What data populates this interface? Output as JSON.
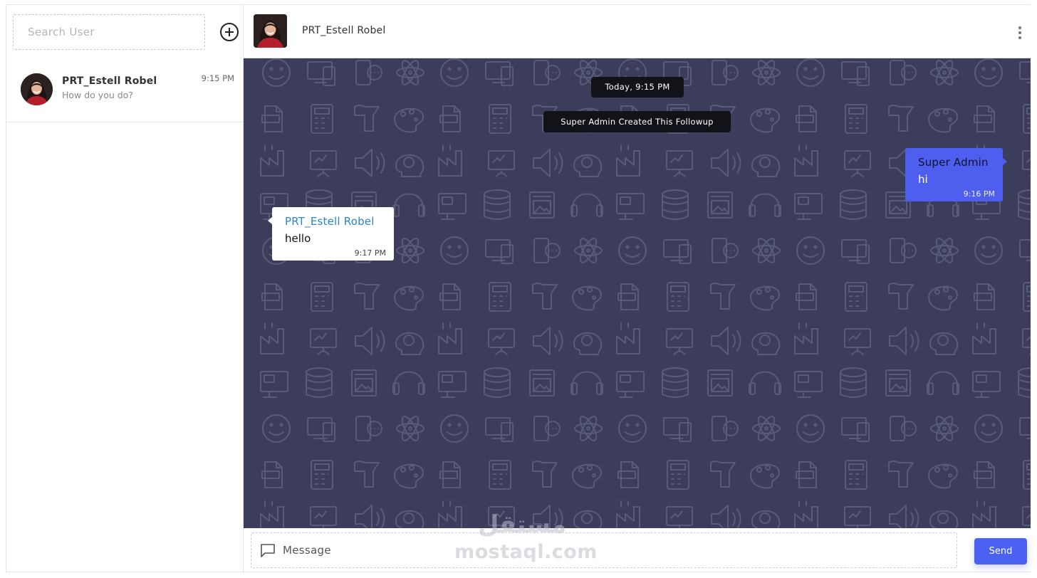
{
  "sidebar": {
    "search": {
      "placeholder": "Search User",
      "value": ""
    },
    "add_icon": "plus-circle-icon",
    "contacts": [
      {
        "name": "PRT_Estell Robel",
        "preview": "How do you do?",
        "time": "9:15 PM"
      }
    ]
  },
  "chat": {
    "header": {
      "title": "PRT_Estell Robel",
      "menu_icon": "vertical-dots-icon"
    },
    "date_divider": "Today, 9:15 PM",
    "system_message": "Super Admin Created This Followup",
    "messages": [
      {
        "direction": "outgoing",
        "sender": "Super Admin",
        "text": "hi",
        "time": "9:16 PM"
      },
      {
        "direction": "incoming",
        "sender": "PRT_Estell Robel",
        "text": "hello",
        "time": "9:17 PM"
      }
    ],
    "composer": {
      "placeholder": "Message",
      "value": "",
      "send_label": "Send",
      "icon": "message-bubble-icon"
    }
  },
  "watermark": {
    "arabic": "مستقل",
    "latin": "mostaql.com"
  },
  "colors": {
    "chat_background": "#3b3d5a",
    "outgoing_bubble": "#4e5ff0",
    "send_button": "#4a61f1",
    "incoming_sender": "#2a86c8"
  }
}
